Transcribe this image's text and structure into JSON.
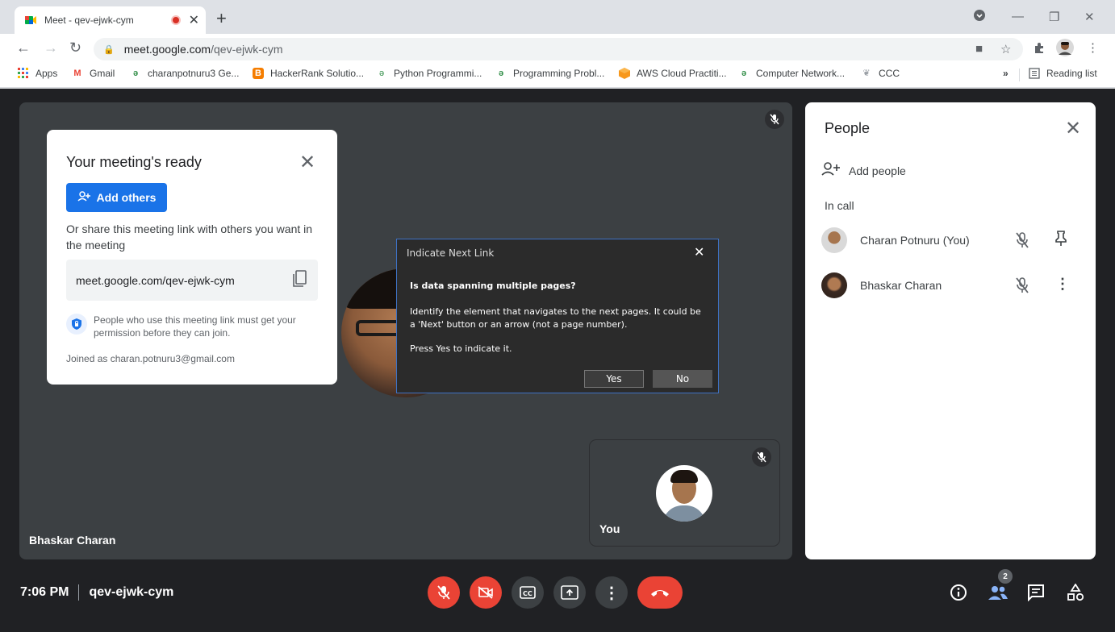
{
  "browser": {
    "tab_title": "Meet - qev-ejwk-cym",
    "url_host": "meet.google.com",
    "url_path": "/qev-ejwk-cym"
  },
  "bookmarks": [
    {
      "label": "Apps",
      "icon": "apps-grid-icon"
    },
    {
      "label": "Gmail",
      "icon": "gmail-icon"
    },
    {
      "label": "charanpotnuru3 Ge...",
      "icon": "geeksforgeeks-icon"
    },
    {
      "label": "HackerRank Solutio...",
      "icon": "blogger-icon"
    },
    {
      "label": "Python Programmi...",
      "icon": "geeksforgeeks-icon"
    },
    {
      "label": "Programming Probl...",
      "icon": "geeksforgeeks-icon"
    },
    {
      "label": "AWS Cloud Practiti...",
      "icon": "aws-icon"
    },
    {
      "label": "Computer Network...",
      "icon": "geeksforgeeks-icon"
    },
    {
      "label": "CCC",
      "icon": "leaf-icon"
    }
  ],
  "reading_list": "Reading list",
  "meeting_card": {
    "title": "Your meeting's ready",
    "add_others": "Add others",
    "share_text": "Or share this meeting link with others you want in the meeting",
    "link": "meet.google.com/qev-ejwk-cym",
    "permission_text": "People who use this meeting link must get your permission before they can join.",
    "joined_as": "Joined as charan.potnuru3@gmail.com"
  },
  "dialog": {
    "title": "Indicate Next Link",
    "question": "Is data spanning multiple pages?",
    "body": "Identify the element that navigates to the next pages. It could be a 'Next' button or an arrow (not a page number).",
    "press": "Press Yes to indicate it.",
    "yes": "Yes",
    "no": "No"
  },
  "stage": {
    "speaker_name": "Bhaskar Charan",
    "self_label": "You"
  },
  "people_panel": {
    "title": "People",
    "add_people": "Add people",
    "in_call": "In call",
    "participants": [
      {
        "name": "Charan Potnuru (You)",
        "action_icon": "pin-icon"
      },
      {
        "name": "Bhaskar Charan",
        "action_icon": "more-vert-icon"
      }
    ]
  },
  "bottom": {
    "time": "7:06 PM",
    "meeting_code": "qev-ejwk-cym",
    "participant_count": "2"
  },
  "colors": {
    "accent_blue": "#1a73e8",
    "danger_red": "#ea4335",
    "meet_bg": "#202124"
  }
}
